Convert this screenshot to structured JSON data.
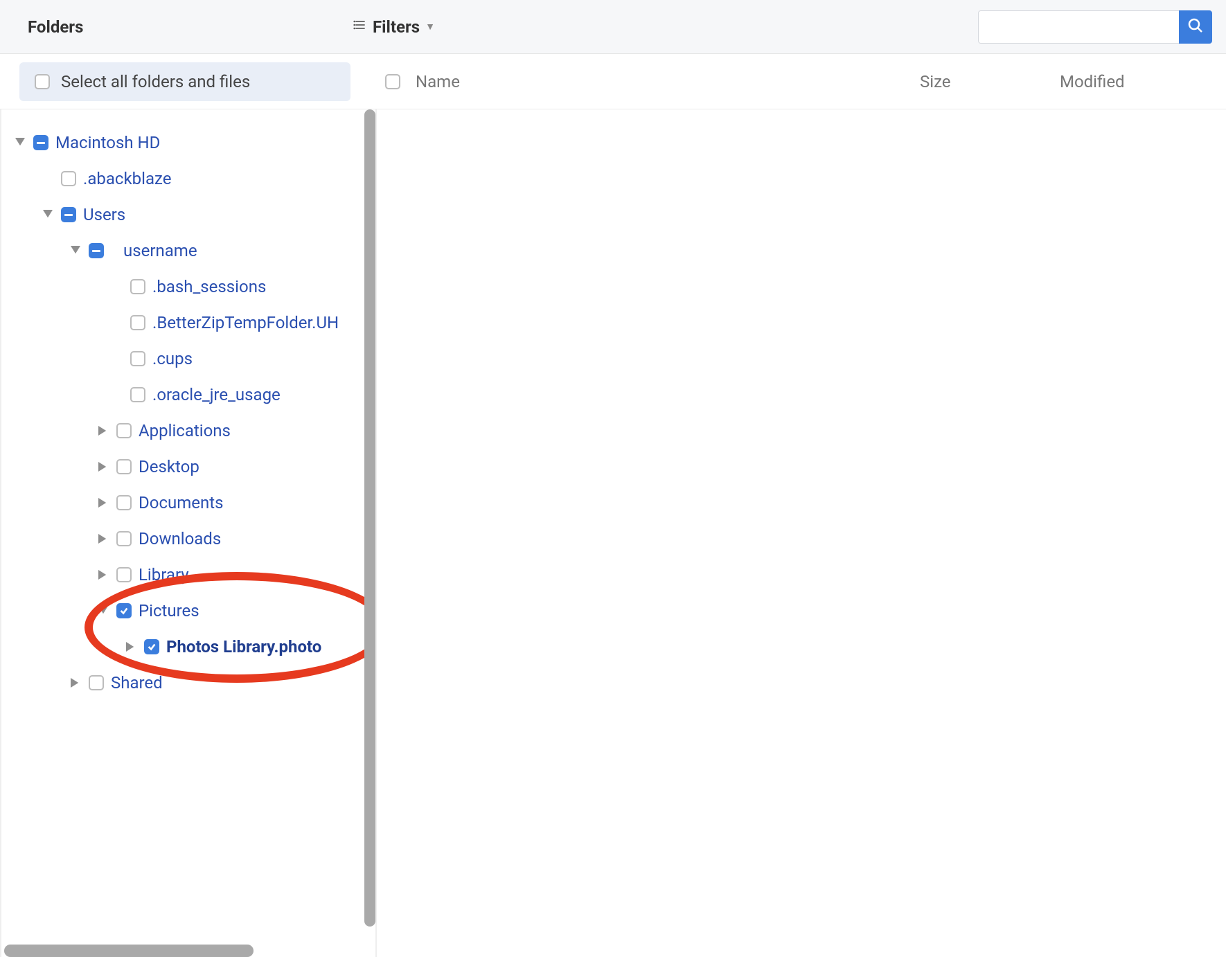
{
  "header": {
    "folders_label": "Folders",
    "filters_label": "Filters",
    "search_value": ""
  },
  "subheader": {
    "select_all_label": "Select all folders and files",
    "col_name": "Name",
    "col_size": "Size",
    "col_modified": "Modified"
  },
  "tree": {
    "root": {
      "label": "Macintosh HD",
      "state": "indeterminate",
      "expanded": true,
      "children": [
        {
          "label": ".abackblaze",
          "state": "unchecked",
          "expanded": null
        },
        {
          "label": "Users",
          "state": "indeterminate",
          "expanded": true,
          "children": [
            {
              "label": "username",
              "state": "indeterminate",
              "expanded": true,
              "children": [
                {
                  "label": ".bash_sessions",
                  "state": "unchecked",
                  "expanded": null
                },
                {
                  "label": ".BetterZipTempFolder.UH",
                  "state": "unchecked",
                  "expanded": null
                },
                {
                  "label": ".cups",
                  "state": "unchecked",
                  "expanded": null
                },
                {
                  "label": ".oracle_jre_usage",
                  "state": "unchecked",
                  "expanded": null
                },
                {
                  "label": "Applications",
                  "state": "unchecked",
                  "expanded": false
                },
                {
                  "label": "Desktop",
                  "state": "unchecked",
                  "expanded": false
                },
                {
                  "label": "Documents",
                  "state": "unchecked",
                  "expanded": false
                },
                {
                  "label": "Downloads",
                  "state": "unchecked",
                  "expanded": false
                },
                {
                  "label": "Library",
                  "state": "unchecked",
                  "expanded": false
                },
                {
                  "label": "Pictures",
                  "state": "checked",
                  "expanded": true,
                  "children": [
                    {
                      "label": "Photos Library.photo",
                      "state": "checked",
                      "expanded": false,
                      "bold": true
                    }
                  ]
                }
              ]
            },
            {
              "label": "Shared",
              "state": "unchecked",
              "expanded": false
            }
          ]
        }
      ]
    }
  }
}
